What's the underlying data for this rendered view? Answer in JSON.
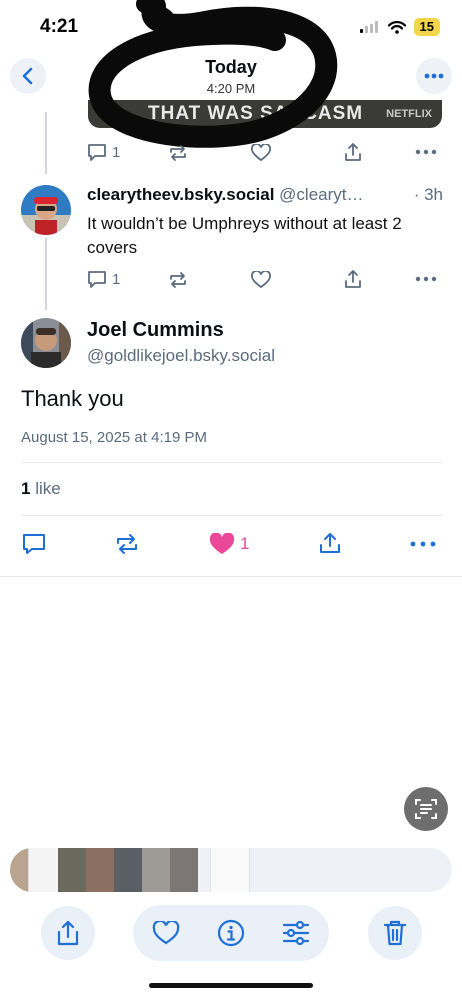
{
  "status_bar": {
    "time": "4:21",
    "battery": "15"
  },
  "header": {
    "title": "Today",
    "subtitle": "4:20 PM"
  },
  "prev_post": {
    "banner_text": "THAT WAS SARCASM",
    "banner_badge": "NETFLIX",
    "reply_count": "1"
  },
  "reply": {
    "display_name": "clearytheev.bsky.social",
    "handle": "@clearyt…",
    "time": "· 3h",
    "text": "It wouldn’t be Umphreys without at least 2 covers",
    "reply_count": "1"
  },
  "main_post": {
    "author_name": "Joel Cummins",
    "author_handle": "@goldlikejoel.bsky.social",
    "text": "Thank you",
    "timestamp": "August 15, 2025 at 4:19 PM",
    "likes_count": "1",
    "likes_label": "like",
    "like_action_count": "1"
  },
  "colors": {
    "accent": "#1f6fd6",
    "like": "#ec4899",
    "muted": "#5b6b7d"
  },
  "icons": [
    "back-icon",
    "more-icon",
    "reply-icon",
    "repost-icon",
    "heart-icon",
    "share-icon",
    "live-text-icon",
    "info-icon",
    "adjust-icon",
    "trash-icon"
  ]
}
